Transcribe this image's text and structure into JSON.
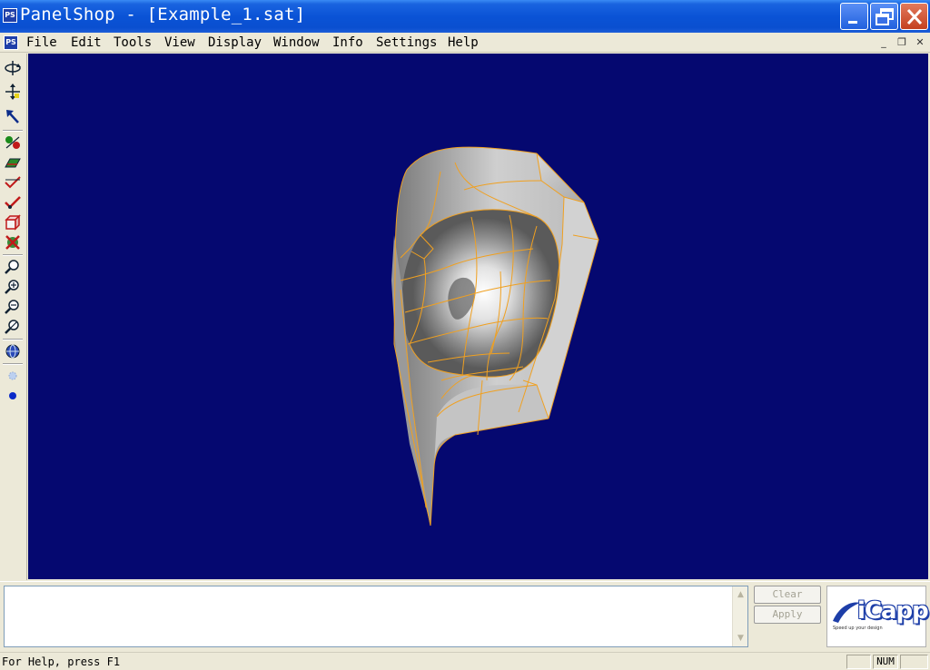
{
  "window": {
    "app_icon": "PS",
    "title": "PanelShop - [Example_1.sat]",
    "minimize_icon": "minimize-icon",
    "maximize_icon": "restore-icon",
    "close_icon": "close-icon"
  },
  "menubar": {
    "doc_icon": "PS",
    "items": [
      "File",
      "Edit",
      "Tools",
      "View",
      "Display",
      "Window",
      "Info",
      "Settings",
      "Help"
    ],
    "mdi_minimize": "_",
    "mdi_restore": "❐",
    "mdi_close": "✕"
  },
  "toolbar": {
    "tools": [
      {
        "icon": "rotate-view-icon"
      },
      {
        "icon": "pan-view-icon"
      },
      {
        "icon": "select-arrow-icon"
      },
      {
        "icon": "pick-entity-icon"
      },
      {
        "icon": "surface-panel-icon"
      },
      {
        "icon": "check-edge-icon"
      },
      {
        "icon": "check-vertex-icon"
      },
      {
        "icon": "solid-box-icon"
      },
      {
        "icon": "delete-entity-icon"
      },
      {
        "icon": "zoom-icon"
      },
      {
        "icon": "zoom-in-icon"
      },
      {
        "icon": "zoom-out-icon"
      },
      {
        "icon": "zoom-fit-icon"
      },
      {
        "icon": "globe-view-icon"
      },
      {
        "icon": "point-light-icon"
      },
      {
        "icon": "point-solid-icon"
      }
    ]
  },
  "viewport": {
    "background_color": "#050870",
    "edge_color": "#f0a020"
  },
  "console": {
    "output_text": "",
    "clear_label": "Clear",
    "apply_label": "Apply",
    "scroll_up": "▲",
    "scroll_down": "▼"
  },
  "logo": {
    "brand": "iCapp",
    "tagline": "Speed up your design"
  },
  "statusbar": {
    "message": "For Help, press F1",
    "pane_1": "",
    "pane_num": "NUM",
    "pane_3": ""
  }
}
